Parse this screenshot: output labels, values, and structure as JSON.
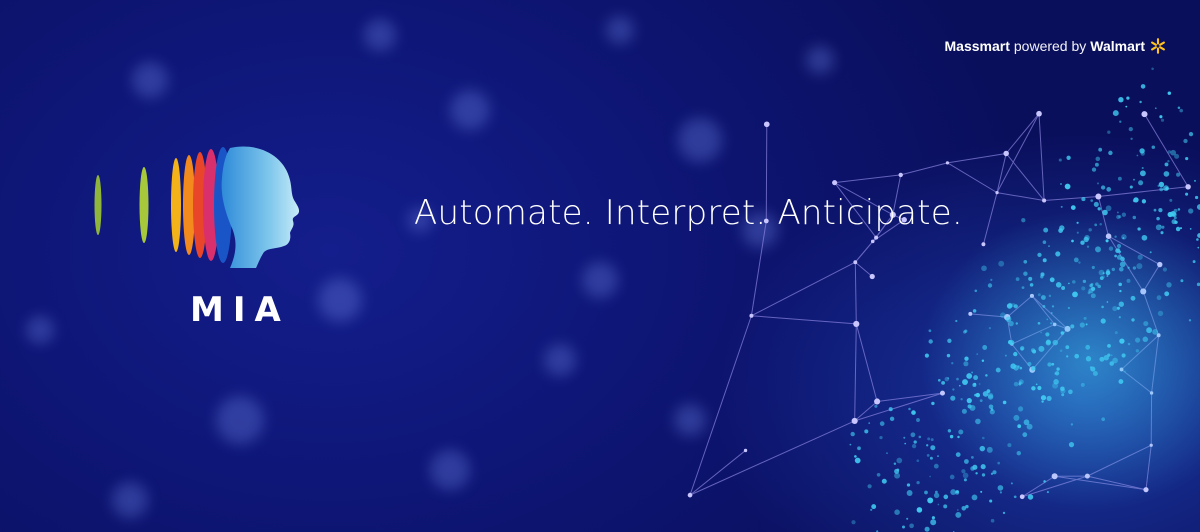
{
  "brand": {
    "name": "Massmart",
    "connector": "powered by",
    "partner": "Walmart",
    "icon": "walmart-spark-icon",
    "spark_color": "#ffc220"
  },
  "logo": {
    "wordmark": "MIA",
    "icon": "mia-head-profile-icon",
    "stripe_colors": [
      "#8fb53c",
      "#a7c83a",
      "#f4b21a",
      "#f28a1e",
      "#e8452a",
      "#d92f6d",
      "#1a55c8",
      "#2f8bd8",
      "#b9e2f3"
    ]
  },
  "tagline": "Automate. Interpret. Anticipate.",
  "theme": {
    "background": "#0e1677",
    "particle_color": "#3fc8f0",
    "network_line_color": "#8a84e0",
    "text_color": "#ffffff"
  }
}
